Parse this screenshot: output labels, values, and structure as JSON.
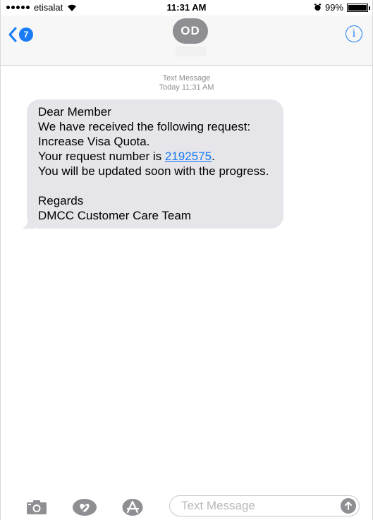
{
  "status_bar": {
    "carrier": "etisalat",
    "time": "11:31 AM",
    "battery": "99%"
  },
  "header": {
    "unread_count": "7",
    "avatar_initials": "OD",
    "info_glyph": "i"
  },
  "conversation": {
    "message_type": "Text Message",
    "timestamp": "Today 11:31 AM",
    "message": {
      "line_1": "Dear Member",
      "line_2": "We have received the following request: Increase Visa Quota.",
      "line_3_prefix": "Your request number is ",
      "request_number": "2192575",
      "line_3_suffix": ".",
      "line_4": "You will be updated soon with the progress.",
      "signoff_1": "Regards",
      "signoff_2": "DMCC Customer Care Team"
    }
  },
  "composer": {
    "placeholder": "Text Message"
  },
  "colors": {
    "accent": "#1a7cf5",
    "bubble": "#e5e5ea",
    "avatar": "#8e8e93"
  },
  "icons": [
    "signal-dots-icon",
    "wifi-icon",
    "alarm-icon",
    "battery-icon",
    "back-chevron-icon",
    "info-icon",
    "camera-icon",
    "digital-touch-heart-icon",
    "app-store-icon",
    "send-arrow-icon"
  ]
}
